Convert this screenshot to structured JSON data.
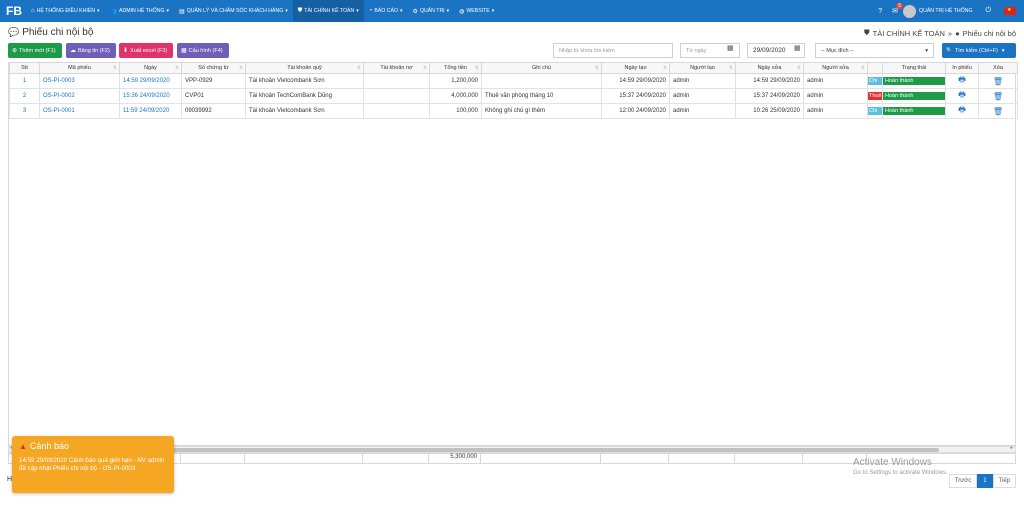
{
  "navbar": {
    "brand": "FB",
    "items": [
      {
        "label": "HỆ THỐNG ĐIỀU KHIỂN",
        "icon": "dashboard-icon"
      },
      {
        "label": "ADMIN HỆ THỐNG",
        "icon": "users-icon"
      },
      {
        "label": "QUẢN LÝ VÀ CHĂM SÓC KHÁCH HÀNG",
        "icon": "contacts-icon"
      },
      {
        "label": "TÀI CHÍNH KẾ TOÁN",
        "icon": "shield-icon"
      },
      {
        "label": "BÁO CÁO",
        "icon": "chart-icon"
      },
      {
        "label": "QUẢN TRỊ",
        "icon": "gear-icon"
      },
      {
        "label": "WEBSITE",
        "icon": "globe-icon"
      }
    ],
    "notification_count": "5",
    "user_name": "QUẢN TRỊ HỆ THỐNG"
  },
  "page": {
    "title": "Phiếu chi nội bộ",
    "breadcrumb": [
      "TÀI CHÍNH KẾ TOÁN",
      "Phiếu chi nội bộ"
    ]
  },
  "toolbar": {
    "add_label": "Thêm mới (F1)",
    "newsletter_label": "Bảng tin (F2)",
    "export_label": "Xuất excel (F3)",
    "config_label": "Cấu hình (F4)",
    "search_placeholder": "Nhập từ khóa tìm kiếm",
    "from_date_placeholder": "Từ ngày",
    "to_date_value": "29/09/2020",
    "purpose_value": "-- Mục đích --",
    "search_label": "Tìm kiếm (Ctrl+F)"
  },
  "table": {
    "headers": [
      "Stt",
      "Mã phiếu",
      "Ngày",
      "Số chứng từ",
      "Tài khoản quỹ",
      "Tài khoản nợ",
      "Tổng tiền",
      "Ghi chú",
      "Ngày tạo",
      "Người tạo",
      "Ngày sửa",
      "Người sửa",
      "",
      "Trạng thái",
      "In phiếu",
      "Xóa"
    ],
    "rows": [
      {
        "stt": "1",
        "code": "OS-PI-0003",
        "date": "14:59 29/09/2020",
        "doc": "VPP-0929",
        "fund": "Tài khoản Vietcombank Sơn",
        "debit": "",
        "total": "1,200,000",
        "note": "",
        "created": "14:59 29/09/2020",
        "creator": "admin",
        "modified": "14:59 29/09/2020",
        "modifier": "admin",
        "type": "Chi",
        "status": "Hoàn thành"
      },
      {
        "stt": "2",
        "code": "OS-PI-0002",
        "date": "15:36 24/09/2020",
        "doc": "CVP01",
        "fund": "Tài khoản TechComBank Dũng",
        "debit": "",
        "total": "4,000,000",
        "note": "Thuê văn phòng tháng 10",
        "created": "15:37 24/09/2020",
        "creator": "admin",
        "modified": "15:37 24/09/2020",
        "modifier": "admin",
        "type": "Thuê",
        "status": "Hoàn thành"
      },
      {
        "stt": "3",
        "code": "OS-PI-0001",
        "date": "11:59 24/09/2020",
        "doc": "09039992",
        "fund": "Tài khoản Vietcombank Sơn",
        "debit": "",
        "total": "100,000",
        "note": "Không ghi chú gì thêm",
        "created": "12:00 24/09/2020",
        "creator": "admin",
        "modified": "10:26 25/09/2020",
        "modifier": "admin",
        "type": "Chi",
        "status": "Hoàn thành"
      }
    ],
    "grand_total": "5,300,000"
  },
  "alert": {
    "title": "Cảnh báo",
    "message": "14:59 29/09/2020 Cảnh báo quá giới hạn - NV admin đã cập nhật Phiếu chi nội bộ - OS-PI-0003"
  },
  "watermark": {
    "line1": "Activate Windows",
    "line2": "Go to Settings to activate Windows."
  },
  "pager": {
    "prev": "Trước",
    "current": "1",
    "next": "Tiếp"
  },
  "footer_left": "H",
  "colors": {
    "primary": "#1b73c4",
    "success": "#1e9b47",
    "danger": "#e2322c",
    "info": "#5bc0de",
    "warning": "#f5a623"
  }
}
